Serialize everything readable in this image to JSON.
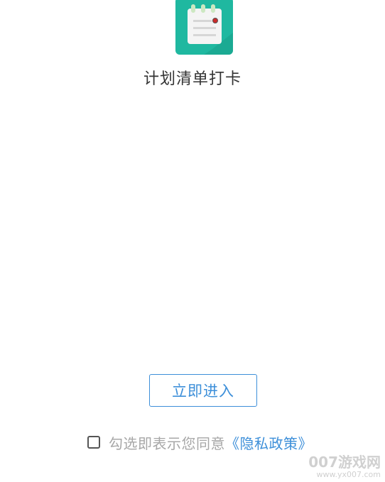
{
  "app": {
    "name": "计划清单打卡",
    "icon": "notepad-icon",
    "icon_color": "#1fb8a0"
  },
  "enter_button": {
    "label": "立即进入",
    "color": "#3d8fd9"
  },
  "privacy": {
    "checked": false,
    "text": "勾选即表示您同意",
    "link": "《隐私政策》"
  },
  "watermark": {
    "main": "007游戏网",
    "url": "www.yx007.com"
  }
}
